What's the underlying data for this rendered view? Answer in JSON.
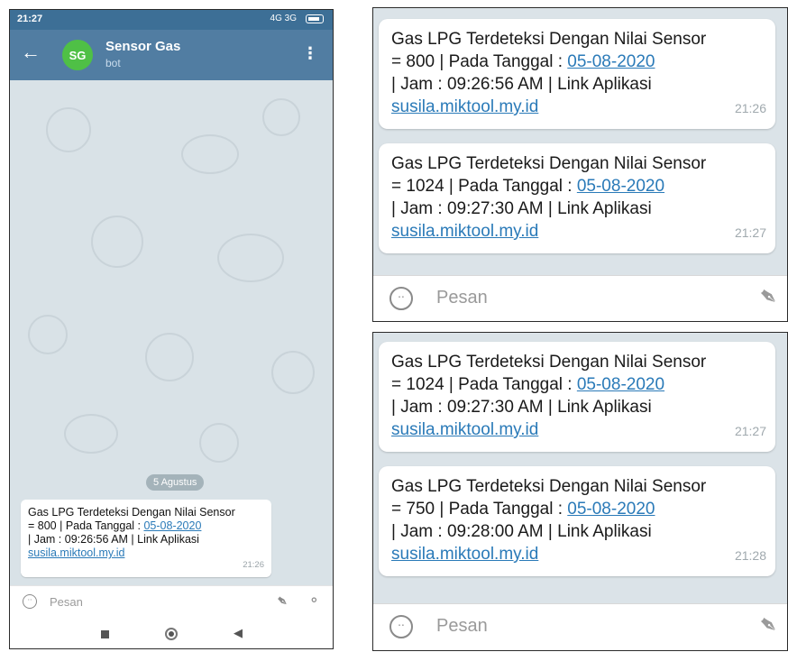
{
  "status_bar": {
    "time": "21:27",
    "signal": "4G 3G"
  },
  "app_bar": {
    "back_icon": "arrow-left-icon",
    "avatar_initials": "SG",
    "title": "Sensor Gas",
    "subtitle": "bot",
    "menu_icon": "more-vertical-icon"
  },
  "chat": {
    "date_separator": "5 Agustus",
    "message": {
      "line1": "Gas LPG Terdeteksi Dengan Nilai Sensor",
      "line2_prefix": "= 800 | Pada Tanggal : ",
      "date_link": "05-08-2020",
      "line3": "| Jam : 09:26:56 AM | Link Aplikasi",
      "url": "susila.miktool.my.id",
      "time": "21:26"
    }
  },
  "input": {
    "placeholder": "Pesan",
    "emoji_icon": "smiley-icon",
    "attach_icon": "paperclip-icon",
    "mic_icon": "microphone-icon"
  },
  "nav": {
    "recent_icon": "square-icon",
    "home_icon": "circle-icon",
    "back_icon": "triangle-back-icon"
  },
  "zoom_panel_1": {
    "messages": [
      {
        "line1": "Gas LPG Terdeteksi Dengan Nilai Sensor",
        "line2_prefix": "= 800 | Pada Tanggal : ",
        "date_link": "05-08-2020",
        "line3": "| Jam : 09:26:56 AM | Link Aplikasi",
        "url": "susila.miktool.my.id",
        "time": "21:26"
      },
      {
        "line1": "Gas LPG Terdeteksi Dengan Nilai Sensor",
        "line2_prefix": "= 1024 | Pada Tanggal : ",
        "date_link": "05-08-2020",
        "line3": "| Jam : 09:27:30 AM | Link Aplikasi",
        "url": "susila.miktool.my.id",
        "time": "21:27"
      }
    ],
    "placeholder": "Pesan"
  },
  "zoom_panel_2": {
    "messages": [
      {
        "line1": "Gas LPG Terdeteksi Dengan Nilai Sensor",
        "line2_prefix": "= 1024 | Pada Tanggal : ",
        "date_link": "05-08-2020",
        "line3": "| Jam : 09:27:30 AM | Link Aplikasi",
        "url": "susila.miktool.my.id",
        "time": "21:27"
      },
      {
        "line1": "Gas LPG Terdeteksi Dengan Nilai Sensor",
        "line2_prefix": "= 750 | Pada Tanggal : ",
        "date_link": "05-08-2020",
        "line3": "| Jam : 09:28:00 AM | Link Aplikasi",
        "url": "susila.miktool.my.id",
        "time": "21:28"
      }
    ],
    "placeholder": "Pesan"
  }
}
